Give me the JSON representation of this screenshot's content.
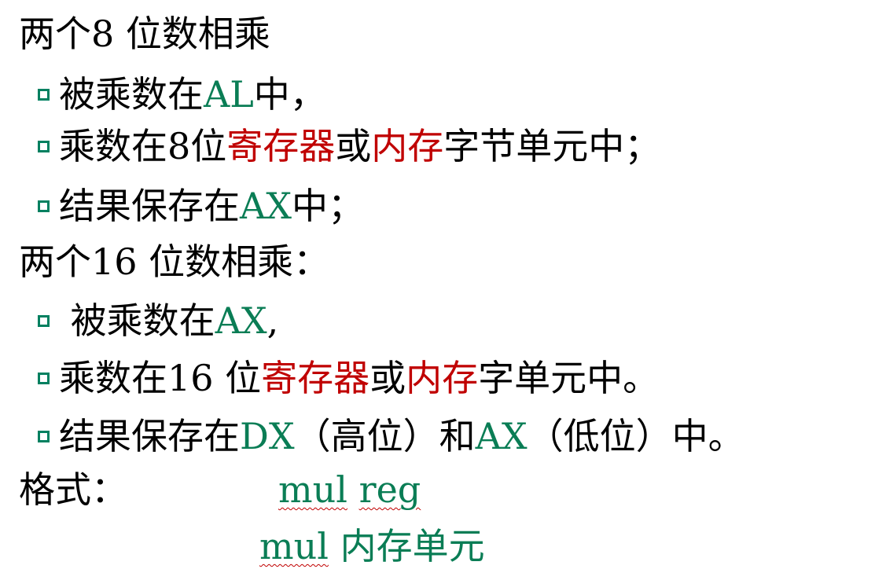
{
  "lines": {
    "l0": {
      "text": "两个8 位数相乘"
    },
    "l1": {
      "t1": "被乘数在",
      "reg": "AL",
      "t2": "中，"
    },
    "l2": {
      "t1": "乘数在8位",
      "r1": "寄存器",
      "t2": "或",
      "r2": "内存",
      "t3": "字节单元中；"
    },
    "l3": {
      "t1": "结果保存在",
      "reg": "AX",
      "t2": "中；"
    },
    "l4": {
      "text": "两个16 位数相乘："
    },
    "l5": {
      "t1": " 被乘数在",
      "reg": "AX",
      "t2": ","
    },
    "l6": {
      "t1": "乘数在16 位",
      "r1": "寄存器",
      "t2": "或",
      "r2": "内存",
      "t3": "字单元中。"
    },
    "l7": {
      "t1": "结果保存在",
      "reg1": "DX",
      "t2": "（高位）和",
      "reg2": "AX",
      "t3": "（低位）中。"
    }
  },
  "format": {
    "label": "格式：",
    "line1_mul": "mul",
    "line1_arg": "reg",
    "line2_mul": "mul",
    "line2_arg": "内存单元"
  },
  "colors": {
    "register_green": "#0a7d55",
    "highlight_red": "#c00000",
    "bullet_green": "#008060"
  }
}
